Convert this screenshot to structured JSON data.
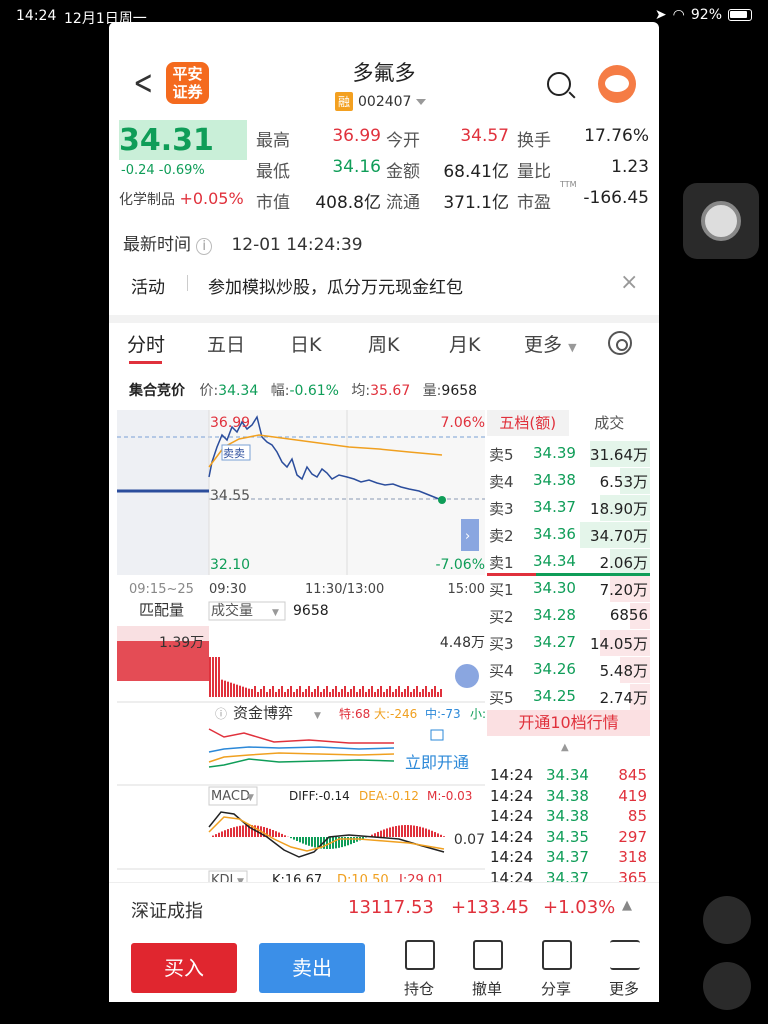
{
  "status": {
    "time": "14:24",
    "date": "12月1日周一",
    "battery": "92%"
  },
  "header": {
    "title": "多氟多",
    "rong": "融",
    "code": "002407",
    "logo_line1": "平安",
    "logo_line2": "证券"
  },
  "quote": {
    "price": "34.31",
    "change": "-0.24",
    "pct": "-0.69%",
    "sector": "化学制品",
    "sector_pct": "+0.05%",
    "fields": [
      {
        "label": "最高",
        "value": "36.99",
        "color": "red"
      },
      {
        "label": "今开",
        "value": "34.57",
        "color": "red"
      },
      {
        "label": "换手",
        "value": "17.76%",
        "color": "dark"
      },
      {
        "label": "最低",
        "value": "34.16",
        "color": "green"
      },
      {
        "label": "金额",
        "value": "68.41亿",
        "color": "dark"
      },
      {
        "label": "量比",
        "value": "1.23",
        "color": "dark"
      },
      {
        "label": "市值",
        "value": "408.8亿",
        "color": "dark"
      },
      {
        "label": "流通",
        "value": "371.1亿",
        "color": "dark"
      },
      {
        "label": "市盈",
        "value": "-166.45",
        "color": "dark"
      }
    ],
    "ttm": "TTM"
  },
  "update": {
    "label": "最新时间",
    "time": "12-01 14:24:39"
  },
  "activity": {
    "label": "活动",
    "text": "参加模拟炒股，瓜分万元现金红包"
  },
  "tabs": [
    "分时",
    "五日",
    "日K",
    "周K",
    "月K",
    "更多"
  ],
  "infobar": {
    "name": "集合竞价",
    "price_label": "价:",
    "price": "34.34",
    "amp_label": "幅:",
    "amp": "-0.61%",
    "avg_label": "均:",
    "avg": "35.67",
    "vol_label": "量:",
    "vol": "9658"
  },
  "chart": {
    "high": "36.99",
    "mid": "34.55",
    "low": "32.10",
    "up_pct": "7.06%",
    "down_pct": "-7.06%",
    "t0": "09:15~25",
    "t1": "09:30",
    "t2": "11:30/13:00",
    "t3": "15:00",
    "match_label": "匹配量",
    "vol_label": "成交量",
    "vol_val": "9658",
    "left_vol": "1.39万",
    "right_vol": "4.48万",
    "sellbuy": "卖卖",
    "fund": {
      "label": "资金博弈",
      "te": "特:68",
      "da": "大:-246",
      "zhong": "中:-73",
      "xiao": "小:",
      "unlock": "立即开通"
    },
    "macd": {
      "label": "MACD",
      "diff": "DIFF:-0.14",
      "dea": "DEA:-0.12",
      "m": "M:-0.03",
      "right": "0.07"
    },
    "kdj": {
      "label": "KDJ",
      "k": "K:16.67",
      "d": "D:10.50",
      "j": "J:29.01"
    }
  },
  "orderbook": {
    "tab1": "五档(额)",
    "tab2": "成交",
    "sells": [
      {
        "l": "卖5",
        "p": "34.39",
        "v": "31.64万"
      },
      {
        "l": "卖4",
        "p": "34.38",
        "v": "6.53万"
      },
      {
        "l": "卖3",
        "p": "34.37",
        "v": "18.90万"
      },
      {
        "l": "卖2",
        "p": "34.36",
        "v": "34.70万"
      },
      {
        "l": "卖1",
        "p": "34.34",
        "v": "2.06万"
      }
    ],
    "buys": [
      {
        "l": "买1",
        "p": "34.30",
        "v": "7.20万"
      },
      {
        "l": "买2",
        "p": "34.28",
        "v": "6856"
      },
      {
        "l": "买3",
        "p": "34.27",
        "v": "14.05万"
      },
      {
        "l": "买4",
        "p": "34.26",
        "v": "5.48万"
      },
      {
        "l": "买5",
        "p": "34.25",
        "v": "2.74万"
      }
    ],
    "open10": "开通10档行情",
    "trades": [
      {
        "t": "14:24",
        "p": "34.34",
        "v": "845"
      },
      {
        "t": "14:24",
        "p": "34.38",
        "v": "419"
      },
      {
        "t": "14:24",
        "p": "34.38",
        "v": "85"
      },
      {
        "t": "14:24",
        "p": "34.35",
        "v": "297"
      },
      {
        "t": "14:24",
        "p": "34.37",
        "v": "318"
      },
      {
        "t": "14:24",
        "p": "34.37",
        "v": "365"
      }
    ]
  },
  "index": {
    "name": "深证成指",
    "value": "13117.53",
    "change": "+133.45",
    "pct": "+1.03%"
  },
  "bottom": {
    "buy": "买入",
    "sell": "卖出",
    "items": [
      "持仓",
      "撤单",
      "分享",
      "更多"
    ]
  },
  "colors": {
    "red": "#e0313c",
    "green": "#0f9d58",
    "blue": "#2b4d9c"
  }
}
